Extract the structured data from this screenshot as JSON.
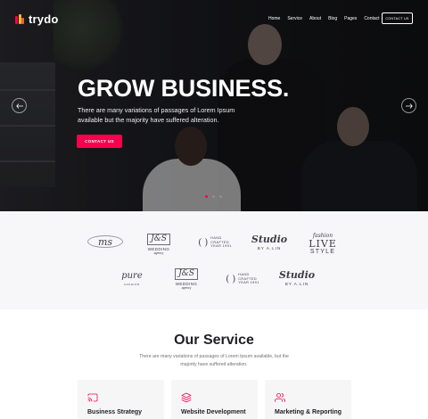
{
  "colors": {
    "accent": "#f9004d",
    "logo_bar_1": "#f9004d",
    "logo_bar_2": "#f7b731",
    "logo_bar_3": "#f0632a"
  },
  "header": {
    "logo_text": "trydo",
    "nav": [
      "Home",
      "Service",
      "About",
      "Blog",
      "Pages",
      "Contact"
    ],
    "cta_label": "CONTACT US"
  },
  "hero": {
    "title": "GROW BUSINESS.",
    "lead": "There are many variations of passages of Lorem Ipsum available but the majority have suffered alteration.",
    "cta_label": "CONTACT US",
    "prev_icon": "arrow-left-icon",
    "next_icon": "arrow-right-icon",
    "slides_count": 3,
    "active_slide": 1
  },
  "brands": [
    {
      "main": "ms",
      "sub": ""
    },
    {
      "main": "J&S",
      "sub": "WEDDING",
      "sub2": "agency"
    },
    {
      "paren": "( )",
      "txt1": "HAND",
      "txt2": "CRAFTED",
      "txt3": "YEAR 1991"
    },
    {
      "main": "Studio",
      "sub": "BY A.LIN"
    },
    {
      "top": "fashion",
      "main": "LIVE",
      "sub": "STYLE"
    },
    {
      "main": "pure",
      "sub": "FASHION"
    },
    {
      "main": "J&S",
      "sub": "WEDDING",
      "sub2": "agency"
    },
    {
      "paren": "( )",
      "txt1": "HAND",
      "txt2": "CRAFTED",
      "txt3": "YEAR 1991"
    },
    {
      "main": "Studio",
      "sub": "BY A.LIN"
    }
  ],
  "service": {
    "title": "Our Service",
    "description": "There are many variations of passages of Lorem Ipsum available, but the majority have suffered alteration.",
    "cards": [
      {
        "icon": "cast-icon",
        "title": "Business Strategy"
      },
      {
        "icon": "layers-icon",
        "title": "Website Development"
      },
      {
        "icon": "users-icon",
        "title": "Marketing & Reporting"
      }
    ]
  }
}
